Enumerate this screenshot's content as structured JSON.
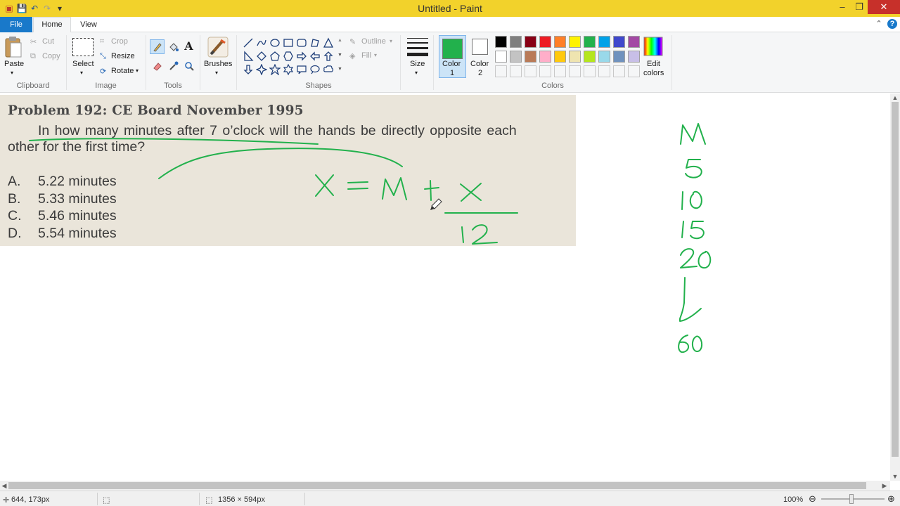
{
  "window": {
    "title": "Untitled - Paint"
  },
  "tabs": {
    "file": "File",
    "home": "Home",
    "view": "View"
  },
  "clipboard": {
    "paste": "Paste",
    "cut": "Cut",
    "copy": "Copy",
    "group": "Clipboard"
  },
  "image": {
    "crop": "Crop",
    "select": "Select",
    "resize": "Resize",
    "rotate": "Rotate",
    "group": "Image"
  },
  "tools": {
    "group": "Tools"
  },
  "brushes": {
    "label": "Brushes"
  },
  "shapes": {
    "outline": "Outline",
    "fill": "Fill",
    "group": "Shapes"
  },
  "size": {
    "label": "Size"
  },
  "colors": {
    "color1_label": "Color",
    "color1_num": "1",
    "color2_label": "Color",
    "color2_num": "2",
    "edit_line1": "Edit",
    "edit_line2": "colors",
    "group": "Colors",
    "color1_value": "#22b14c",
    "color2_value": "#ffffff",
    "palette_row1": [
      "#000000",
      "#7f7f7f",
      "#880015",
      "#ed1c24",
      "#ff7f27",
      "#fff200",
      "#22b14c",
      "#00a2e8",
      "#3f48cc",
      "#a349a4"
    ],
    "palette_row2": [
      "#ffffff",
      "#c3c3c3",
      "#b97a57",
      "#ffaec9",
      "#ffc90e",
      "#efe4b0",
      "#b5e61d",
      "#99d9ea",
      "#7092be",
      "#c8bfe7"
    ],
    "palette_row3": [
      "#f5f6f7",
      "#f5f6f7",
      "#f5f6f7",
      "#f5f6f7",
      "#f5f6f7",
      "#f5f6f7",
      "#f5f6f7",
      "#f5f6f7",
      "#f5f6f7",
      "#f5f6f7"
    ]
  },
  "document": {
    "title": "Problem 192: CE Board November 1995",
    "line1": "In how many minutes after 7 o’clock will the hands be directly opposite each",
    "line2": "other for the first time?",
    "choices": [
      {
        "letter": "A.",
        "text": "5.22 minutes"
      },
      {
        "letter": "B.",
        "text": "5.33 minutes"
      },
      {
        "letter": "C.",
        "text": "5.46 minutes"
      },
      {
        "letter": "D.",
        "text": "5.54 minutes"
      }
    ]
  },
  "handwriting": {
    "ink_color": "#22b14c",
    "equation": "x = M + x / 12",
    "column": [
      "M",
      "5",
      "10",
      "15",
      "20",
      "60"
    ]
  },
  "status": {
    "cursor_pos": "644, 173px",
    "canvas_size": "1356 × 594px",
    "zoom": "100%"
  }
}
